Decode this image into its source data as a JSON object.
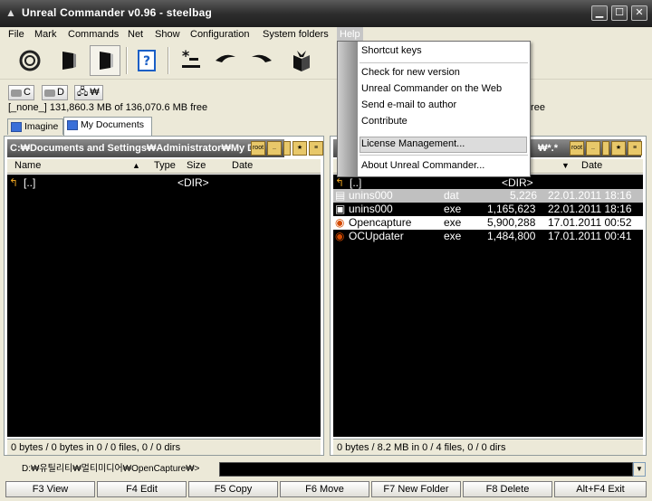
{
  "window": {
    "title": "Unreal Commander v0.96 - steelbag"
  },
  "menubar": {
    "items": [
      "File",
      "Mark",
      "Commands",
      "Net",
      "Show",
      "Configuration",
      "System folders",
      "Help"
    ]
  },
  "toolbar": {
    "icons": [
      "spiral-icon",
      "panel-left-icon",
      "panel-right-icon",
      "help-book-icon",
      "wildcard-select-icon",
      "arrow-left-icon",
      "arrow-right-icon",
      "gift-box-icon"
    ]
  },
  "left": {
    "drives": [
      "C",
      "D"
    ],
    "drive_info": "[_none_]  131,860.3 MB of  136,070.6 MB free",
    "tabs": [
      "Imagine",
      "My Documents"
    ],
    "path": "C:₩Documents and Settings₩Administrator₩My D",
    "columns": {
      "name": "Name",
      "type": "Type",
      "size": "Size",
      "date": "Date"
    },
    "files": [
      {
        "name": "[..]",
        "ext": "",
        "size": "<DIR>",
        "date": ""
      }
    ],
    "status": "0 bytes / 0 bytes in 0 / 0 files, 0 / 0 dirs"
  },
  "right": {
    "drive_info_tail": "free",
    "path_tail": "₩*.*",
    "columns": {
      "date": "Date"
    },
    "files": [
      {
        "name": "[..]",
        "ext": "",
        "size": "<DIR>",
        "date": ""
      },
      {
        "name": "unins000",
        "ext": "dat",
        "size": "5,226",
        "date": "22.01.2011 18:16"
      },
      {
        "name": "unins000",
        "ext": "exe",
        "size": "1,165,623",
        "date": "22.01.2011 18:16"
      },
      {
        "name": "Opencapture",
        "ext": "exe",
        "size": "5,900,288",
        "date": "17.01.2011 00:52"
      },
      {
        "name": "OCUpdater",
        "ext": "exe",
        "size": "1,484,800",
        "date": "17.01.2011 00:41"
      }
    ],
    "status": "0 bytes / 8.2 MB in 0 / 4 files, 0 / 0 dirs"
  },
  "command_line": {
    "prompt": "D:₩유틸리티₩멀티미디어₩OpenCapture₩>",
    "value": ""
  },
  "fkeys": [
    "F3 View",
    "F4 Edit",
    "F5 Copy",
    "F6 Move",
    "F7 New Folder",
    "F8 Delete",
    "Alt+F4 Exit"
  ],
  "help_menu": {
    "items": [
      "Shortcut keys",
      "Check for new version",
      "Unreal Commander on the Web",
      "Send e-mail to author",
      "Contribute",
      "License Management...",
      "About Unreal Commander..."
    ]
  },
  "colors": {
    "titlebar": "#2e2e2e",
    "panel_bg": "#000000",
    "path_bar": "#6a6a6a",
    "selection": "#c0c0c0"
  }
}
